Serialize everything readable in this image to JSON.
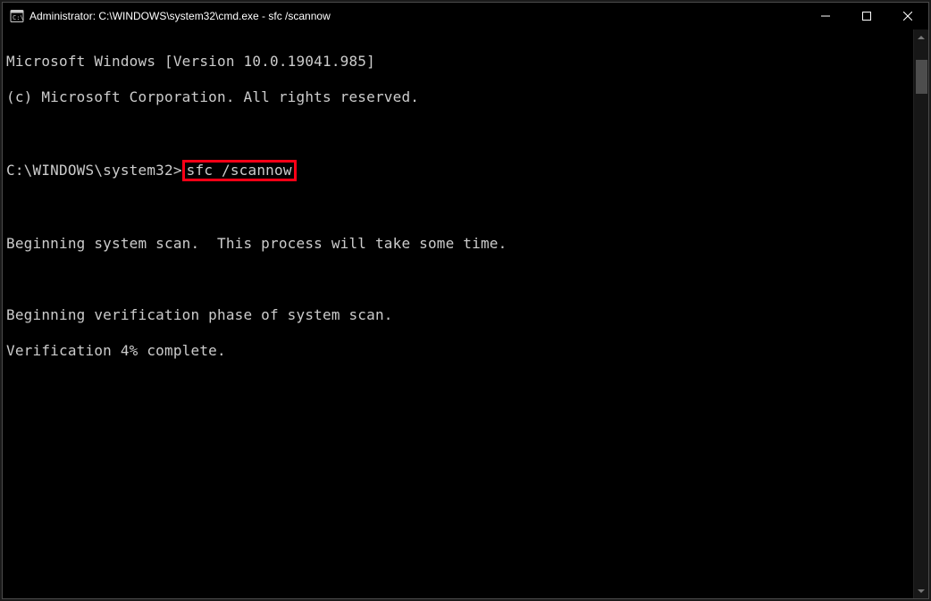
{
  "window": {
    "title": "Administrator: C:\\WINDOWS\\system32\\cmd.exe - sfc  /scannow"
  },
  "console": {
    "line1": "Microsoft Windows [Version 10.0.19041.985]",
    "line2": "(c) Microsoft Corporation. All rights reserved.",
    "blank1": "",
    "prompt": "C:\\WINDOWS\\system32>",
    "command": "sfc /scannow",
    "blank2": "",
    "line3": "Beginning system scan.  This process will take some time.",
    "blank3": "",
    "line4": "Beginning verification phase of system scan.",
    "line5": "Verification 4% complete."
  }
}
